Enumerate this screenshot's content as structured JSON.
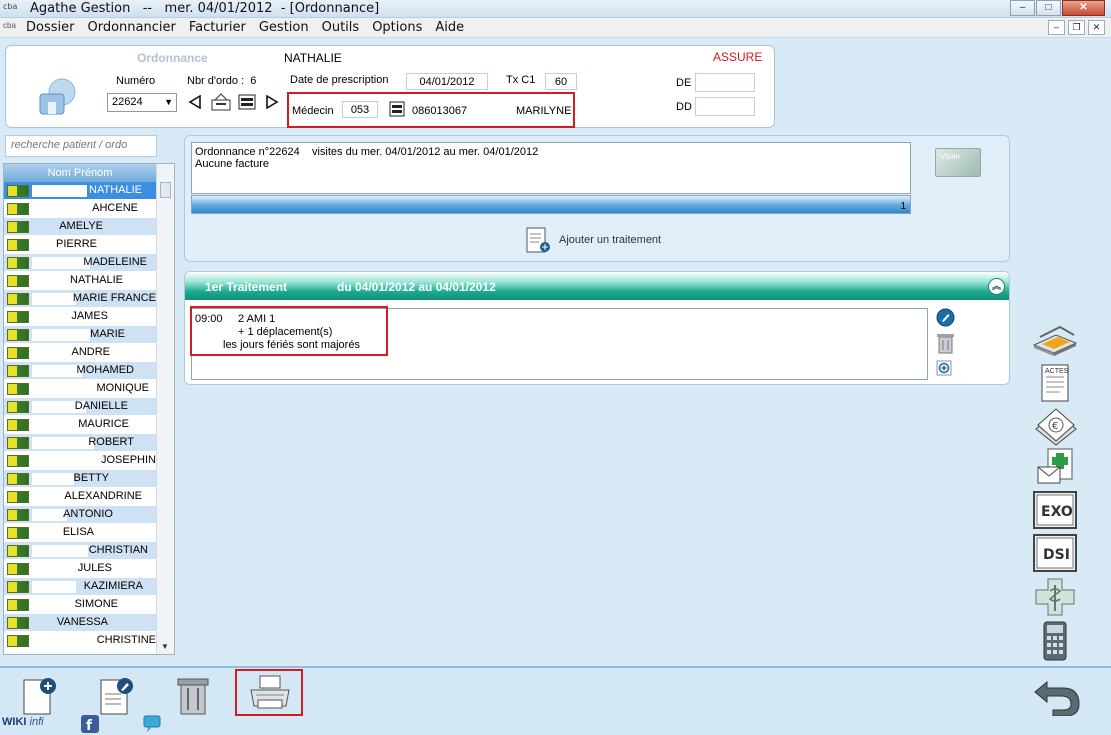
{
  "window": {
    "app_name": "Agathe Gestion",
    "title_sep": "--",
    "date": "mer. 04/01/2012",
    "doc_title": "- [Ordonnance]",
    "app_icon_text": "cba"
  },
  "menu": [
    "Dossier",
    "Ordonnancier",
    "Facturier",
    "Gestion",
    "Outils",
    "Options",
    "Aide"
  ],
  "header": {
    "section_label": "Ordonnance",
    "patient_first_name": "NATHALIE",
    "status": "ASSURE",
    "numero_label": "Numéro",
    "numero_value": "22624",
    "nbr_ordo_label": "Nbr d'ordo :",
    "nbr_ordo_value": "6",
    "date_prescription_label": "Date de prescription",
    "date_prescription_value": "04/01/2012",
    "tx_label": "Tx C1",
    "tx_value": "60",
    "medecin_label": "Médecin",
    "medecin_code": "053",
    "medecin_number": "086013067",
    "medecin_first_name": "MARILYNE",
    "de_label": "DE",
    "dd_label": "DD",
    "de_value": "",
    "dd_value": ""
  },
  "search": {
    "placeholder": "recherche patient / ordo"
  },
  "patients": {
    "header": "Nom Prénom",
    "items": [
      "NATHALIE",
      "AHCENE",
      "AMELYE",
      "PIERRE",
      "MADELEINE",
      "NATHALIE",
      "MARIE FRANCE",
      "JAMES",
      "MARIE",
      "ANDRE",
      "MOHAMED",
      "MONIQUE",
      "DANIELLE",
      "MAURICE",
      "ROBERT",
      "JOSEPHIN",
      "BETTY",
      "ALEXANDRINE",
      "ANTONIO",
      "ELISA",
      "CHRISTIAN",
      "JULES",
      "KAZIMIERA",
      "SIMONE",
      "VANESSA",
      "CHRISTINE"
    ]
  },
  "ordonnance": {
    "line1_number": "Ordonnance n°22624",
    "line1_visits": "visites du mer. 04/01/2012 au mer. 04/01/2012",
    "line2": "Aucune facture",
    "bar_count": "1",
    "vitale_label": "Vitale",
    "add_treatment": "Ajouter un traitement"
  },
  "treatment": {
    "title": "1er Traitement",
    "range": "du 04/01/2012 au 04/01/2012",
    "time": "09:00",
    "act": "2 AMI 1",
    "travel": "+ 1 déplacement(s)",
    "holiday": "les jours fériés sont majorés"
  },
  "toolbar": {
    "actes_label": "ACTES",
    "exo_label": "EXO",
    "dsi_label": "DSI"
  },
  "bottom": {
    "wiki_prefix": "WIKI",
    "wiki_suffix": "infi"
  },
  "colors": {
    "highlight_red": "#d01c25",
    "treatment_header": "#1aab8f",
    "list_selected": "#3c8fe0",
    "status_red": "#d01c25"
  }
}
